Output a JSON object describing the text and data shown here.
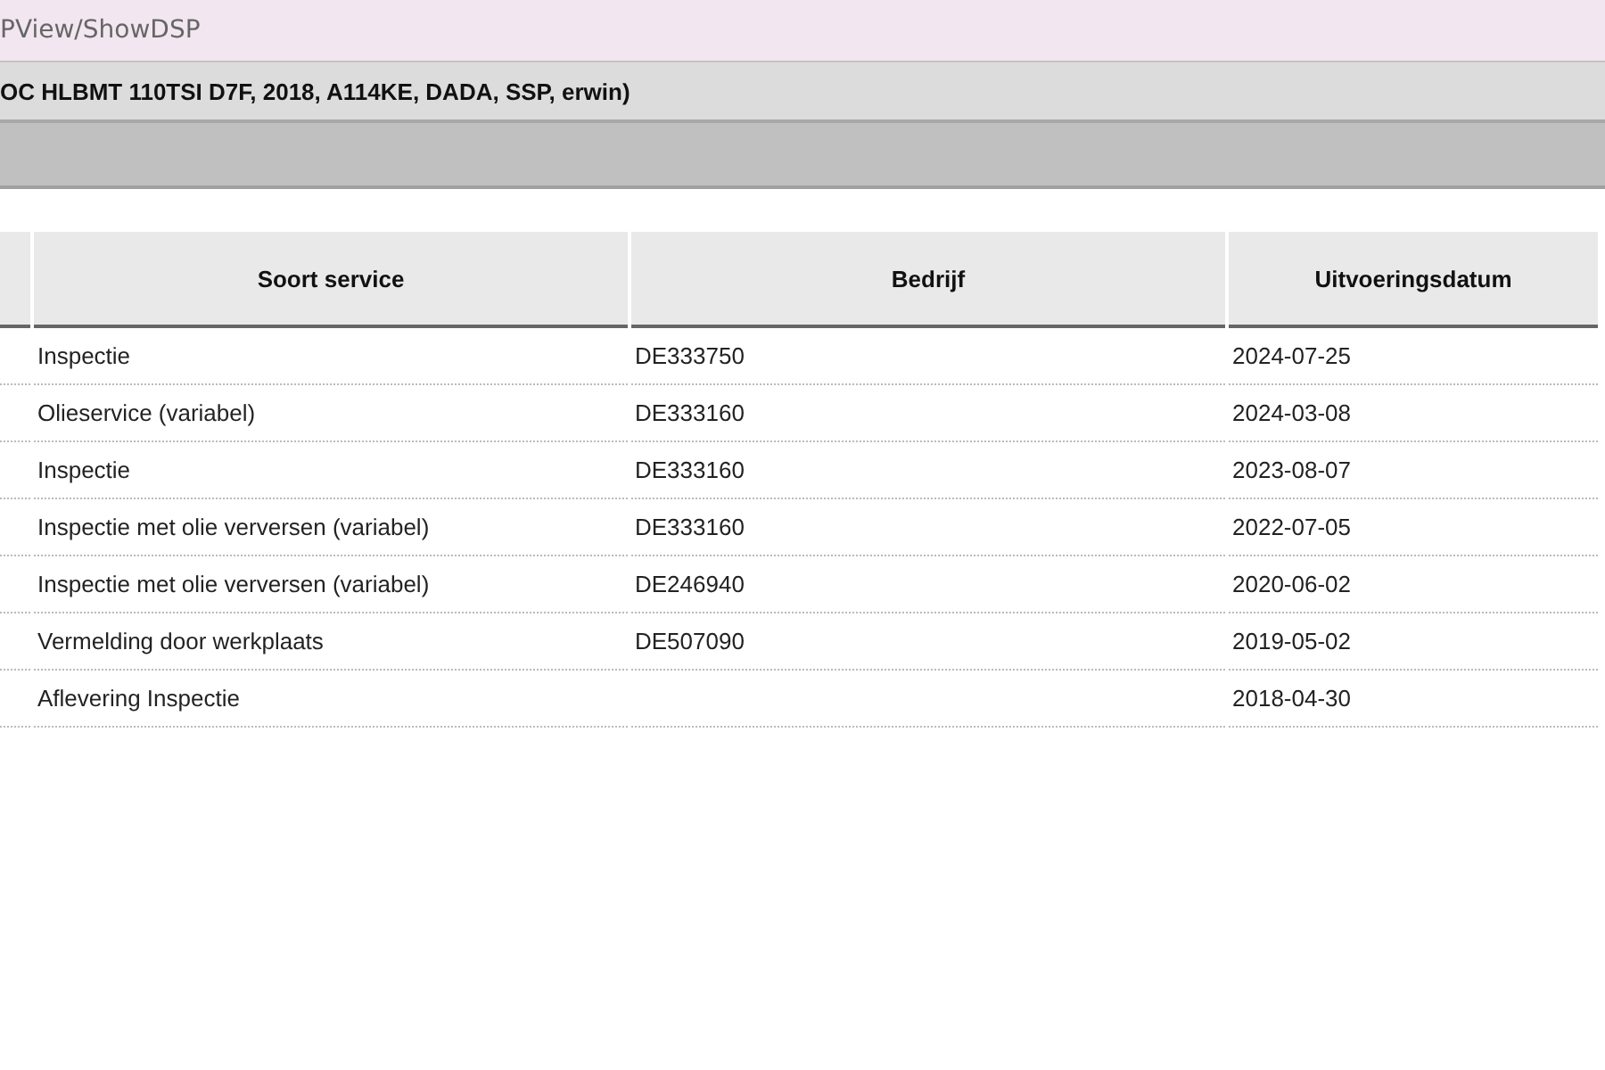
{
  "address_bar": {
    "text": "PView/ShowDSP"
  },
  "vehicle_bar": {
    "text": "OC HLBMT 110TSI D7F, 2018, A114KE, DADA, SSP, erwin)"
  },
  "table": {
    "columns": [
      "Soort service",
      "Bedrijf",
      "Uitvoeringsdatum"
    ],
    "rows": [
      {
        "service": "Inspectie",
        "company": "DE333750",
        "date": "2024-07-25"
      },
      {
        "service": "Olieservice (variabel)",
        "company": "DE333160",
        "date": "2024-03-08"
      },
      {
        "service": "Inspectie",
        "company": "DE333160",
        "date": "2023-08-07"
      },
      {
        "service": "Inspectie met olie verversen (variabel)",
        "company": "DE333160",
        "date": "2022-07-05"
      },
      {
        "service": "Inspectie met olie verversen (variabel)",
        "company": "DE246940",
        "date": "2020-06-02"
      },
      {
        "service": "Vermelding door werkplaats",
        "company": "DE507090",
        "date": "2019-05-02"
      },
      {
        "service": "Aflevering Inspectie",
        "date": "2018-04-30"
      }
    ]
  }
}
